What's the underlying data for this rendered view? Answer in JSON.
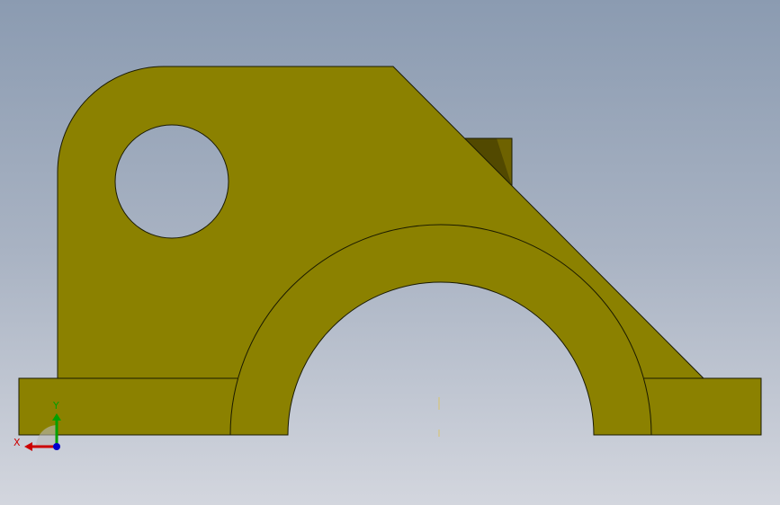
{
  "viewport": {
    "background_top": "#8b9bb1",
    "background_bottom": "#d3d6de"
  },
  "part": {
    "face_color": "#8b8100",
    "edge_color": "#1a1a00",
    "side_face_color": "#6e6200"
  },
  "triad": {
    "x_label": "X",
    "y_label": "Y",
    "x_color": "#cc0000",
    "y_color": "#00a000",
    "z_color": "#0000cc"
  },
  "origin_marker_color": "#d9c46a"
}
